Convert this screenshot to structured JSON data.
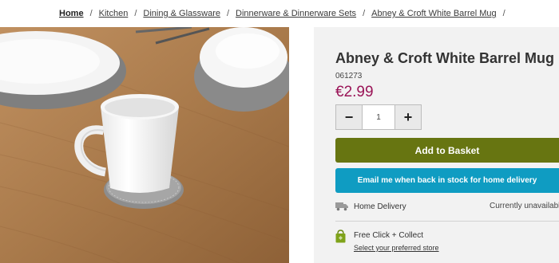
{
  "breadcrumb": {
    "items": [
      "Home",
      "Kitchen",
      "Dining & Glassware",
      "Dinnerware & Dinnerware Sets",
      "Abney & Croft White Barrel Mug"
    ],
    "separator": "/"
  },
  "product": {
    "title": "Abney & Croft White Barrel Mug",
    "sku": "061273",
    "price": "€2.99",
    "image_alt": "white mug on grey coaster on wooden table"
  },
  "quantity": {
    "value": "1",
    "minus_label": "−",
    "plus_label": "+"
  },
  "actions": {
    "add_to_basket": "Add to Basket",
    "email_back_in_stock": "Email me when back in stock for home delivery"
  },
  "delivery": {
    "home_label": "Home Delivery",
    "home_status": "Currently unavailable",
    "click_label": "Free Click + Collect",
    "click_link": "Select your preferred store"
  },
  "colors": {
    "price": "#9a1457",
    "basket_button": "#677511",
    "email_button": "#0f9cc2",
    "panel_bg": "#f2f2f2"
  },
  "icons": {
    "truck": "truck-icon",
    "bag": "shopping-bag-icon",
    "minus": "minus-icon",
    "plus": "plus-icon"
  }
}
